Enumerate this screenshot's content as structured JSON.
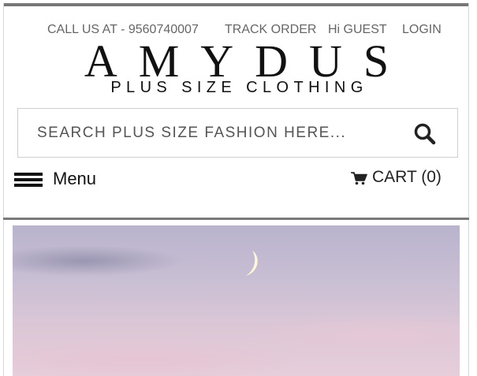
{
  "topbar": {
    "call": "CALL US AT - 9560740007",
    "track_order": "TRACK ORDER",
    "greeting": "Hi GUEST",
    "login": "LOGIN"
  },
  "logo": {
    "name": "AMYDUS",
    "tagline": "PLUS SIZE CLOTHING"
  },
  "search": {
    "placeholder": "SEARCH PLUS SIZE FASHION HERE...",
    "icon": "search-icon"
  },
  "nav": {
    "menu_label": "Menu",
    "menu_icon": "hamburger-icon",
    "cart_label": "CART (0)",
    "cart_icon": "shopping-cart-icon"
  },
  "hero": {
    "description_icon": "crescent-moon-image"
  },
  "colors": {
    "text": "#333333",
    "logo": "#111111",
    "border": "#777777"
  }
}
